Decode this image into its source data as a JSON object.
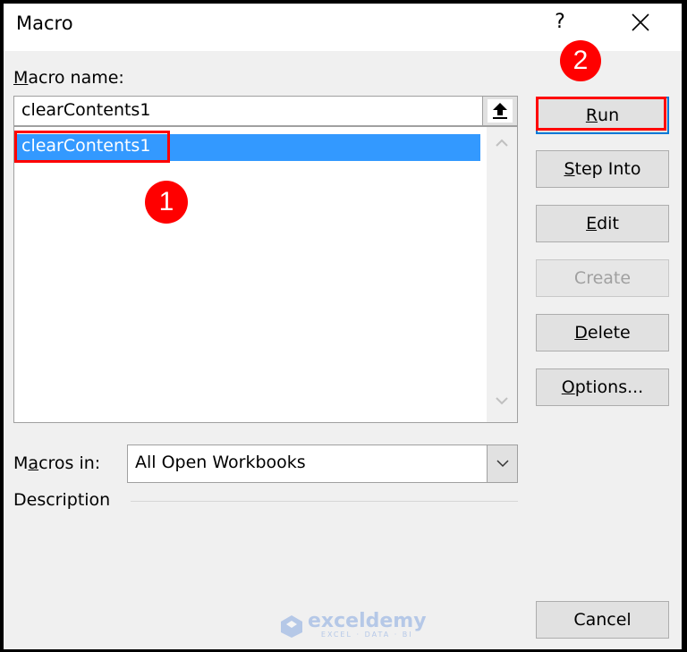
{
  "window": {
    "title": "Macro",
    "help_label": "?",
    "close_icon": "close-icon"
  },
  "macro_name": {
    "label_prefix": "",
    "label_accel": "M",
    "label_rest": "acro name:",
    "input_value": "clearContents1",
    "upload_icon": "upload-arrow-icon"
  },
  "macro_list": {
    "items": [
      {
        "label": "clearContents1",
        "selected": true
      }
    ]
  },
  "buttons": {
    "run": {
      "accel": "R",
      "rest": "un"
    },
    "step_into": {
      "accel": "S",
      "rest": "tep Into"
    },
    "edit": {
      "accel": "E",
      "rest": "dit"
    },
    "create": {
      "label": "Create",
      "disabled": true
    },
    "delete": {
      "accel": "D",
      "rest": "elete"
    },
    "options": {
      "accel": "O",
      "rest": "ptions..."
    },
    "cancel": {
      "label": "Cancel"
    }
  },
  "macros_in": {
    "label_pre": "M",
    "label_accel": "a",
    "label_rest": "cros in:",
    "selected": "All Open Workbooks"
  },
  "description": {
    "label": "Description"
  },
  "annotations": {
    "step1": "1",
    "step2": "2",
    "highlight_color": "#ff0000"
  },
  "watermark": {
    "name": "exceldemy",
    "tagline": "EXCEL · DATA · BI"
  },
  "colors": {
    "selection": "#3399ff",
    "dialog_bg": "#f0f0f0",
    "default_button_border": "#0078d7"
  }
}
